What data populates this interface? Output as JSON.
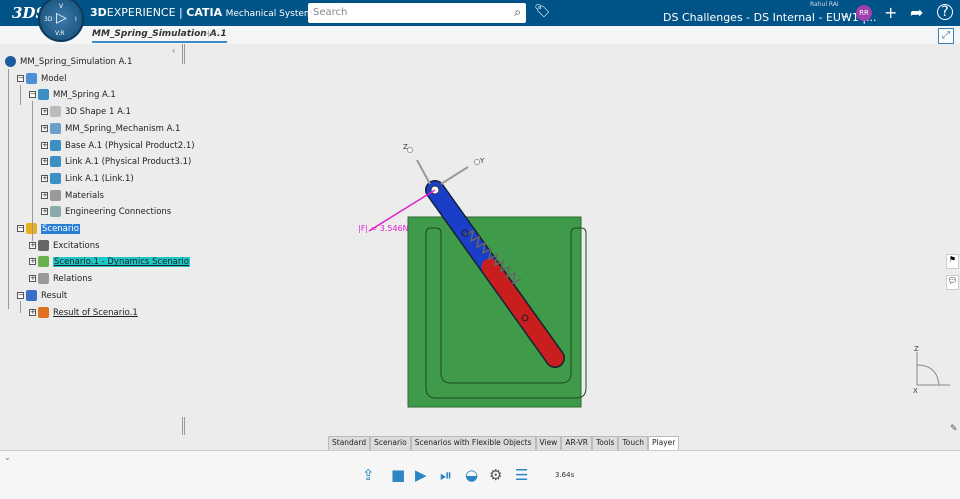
{
  "header": {
    "logo": "3DS",
    "compass": {
      "top": "V",
      "left": "3D",
      "right": "I",
      "bottom": "V.R"
    },
    "brand_bold": "3D",
    "brand_rest": "EXPERIENCE | ",
    "app": "CATIA",
    "role": "Mechanical Systems Exper...",
    "search_placeholder": "Search",
    "user_name": "Rahul RAI",
    "context": "DS Challenges - DS Internal - EUW1 |...",
    "avatar_initials": "RR"
  },
  "tabs": {
    "active": "MM_Spring_Simulation A.1",
    "add": "+"
  },
  "tree": [
    {
      "label": "MM_Spring_Simulation A.1",
      "level": 0,
      "icon": "simulation-icon"
    },
    {
      "label": "Model",
      "level": 1,
      "icon": "model-icon"
    },
    {
      "label": "MM_Spring A.1",
      "level": 2,
      "icon": "product-icon"
    },
    {
      "label": "3D Shape 1 A.1",
      "level": 3,
      "icon": "shape-icon"
    },
    {
      "label": "MM_Spring_Mechanism A.1",
      "level": 3,
      "icon": "mechanism-icon"
    },
    {
      "label": "Base A.1 (Physical Product2.1)",
      "level": 3,
      "icon": "product-icon"
    },
    {
      "label": "Link A.1 (Physical Product3.1)",
      "level": 3,
      "icon": "product-icon"
    },
    {
      "label": "Link A.1 (Link.1)",
      "level": 3,
      "icon": "product-icon"
    },
    {
      "label": "Materials",
      "level": 3,
      "icon": "materials-icon"
    },
    {
      "label": "Engineering Connections",
      "level": 3,
      "icon": "connections-icon"
    },
    {
      "label": "Scenario",
      "level": 1,
      "icon": "scenario-icon",
      "state": "selected"
    },
    {
      "label": "Excitations",
      "level": 2,
      "icon": "excitations-icon"
    },
    {
      "label": "Scenario.1 - Dynamics Scenario",
      "level": 2,
      "icon": "dynamics-scenario-icon",
      "state": "highlighted"
    },
    {
      "label": "Relations",
      "level": 2,
      "icon": "relations-icon"
    },
    {
      "label": "Result",
      "level": 1,
      "icon": "result-icon"
    },
    {
      "label": "Result of Scenario.1",
      "level": 2,
      "icon": "result-item-icon",
      "state": "underlined"
    }
  ],
  "viewport": {
    "force_label": "|F| = 3.546N",
    "axis_z": "Z",
    "axis_y": "Y",
    "axis_x": "X",
    "colors": {
      "base": "#3f9a4a",
      "link_upper": "#1a3ec8",
      "link_lower": "#c81e1e",
      "force": "#e020d0"
    }
  },
  "workbench_tabs": [
    "Standard",
    "Scenario",
    "Scenarios with Flexible Objects",
    "View",
    "AR-VR",
    "Tools",
    "Touch",
    "Player"
  ],
  "active_workbench_tab": "Player",
  "player": {
    "time": "3.64s"
  }
}
